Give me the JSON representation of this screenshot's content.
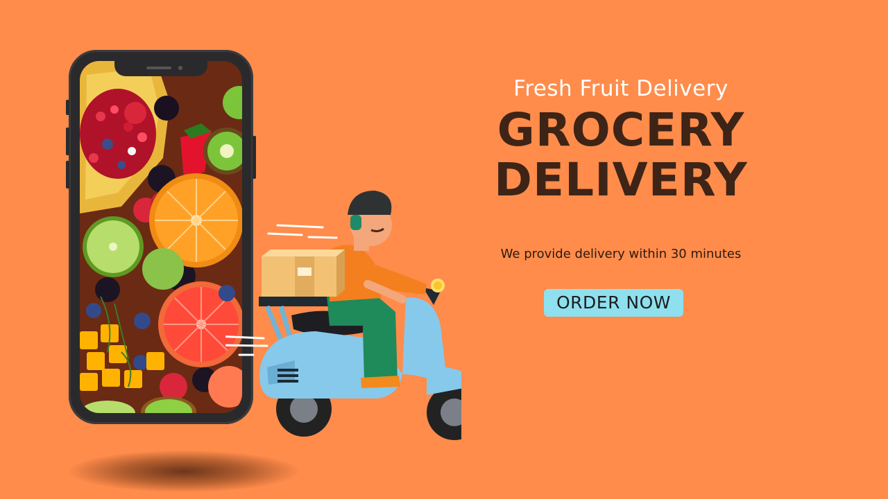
{
  "banner": {
    "tagline": "Fresh Fruit Delivery",
    "headline_line1": "GROCERY",
    "headline_line2": "DELIVERY",
    "description": "We provide delivery within 30 minutes",
    "cta_label": "ORDER NOW"
  },
  "colors": {
    "background": "#ff8c4b",
    "headline": "#3d2416",
    "cta_background": "#8ee0ef",
    "tagline": "#ffffff"
  },
  "illustrations": {
    "phone_content": "fruit-photo-icon",
    "rider": "scooter-delivery-rider-icon",
    "package": "package-box-icon"
  }
}
